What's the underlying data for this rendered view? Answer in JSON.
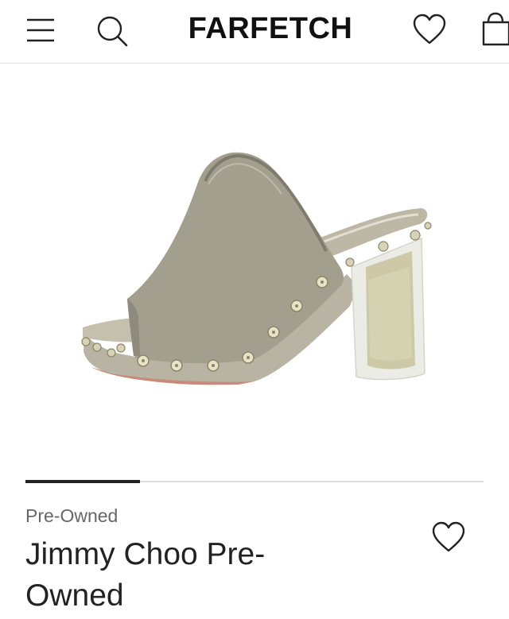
{
  "header": {
    "logo": "FARFETCH",
    "icons": [
      "menu-icon",
      "search-icon",
      "heart-icon",
      "shopping-bag-icon"
    ]
  },
  "product": {
    "image_icon": "shoe-image",
    "carousel_active_fraction": 0.25,
    "condition": "Pre-Owned",
    "title": "Jimmy Choo Pre-Owned",
    "wishlist_icon": "heart-icon"
  },
  "colors": {
    "text": "#222222",
    "muted": "#666666",
    "shoe_suede": "#a39f8e",
    "heel_glitter": "#cdc9a6"
  }
}
